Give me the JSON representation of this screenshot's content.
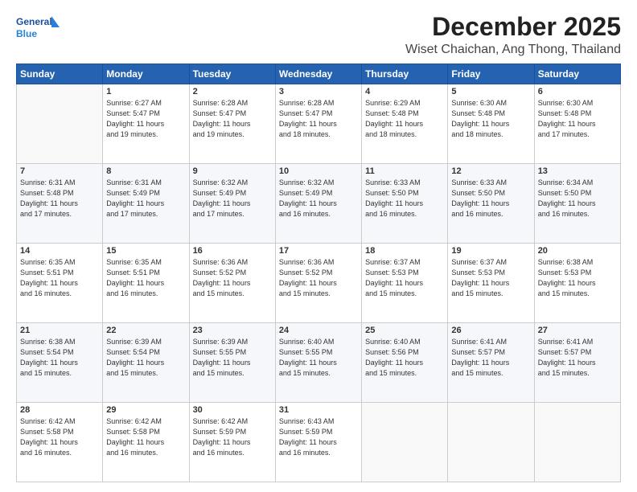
{
  "logo": {
    "line1": "General",
    "line2": "Blue"
  },
  "title": "December 2025",
  "subtitle": "Wiset Chaichan, Ang Thong, Thailand",
  "header_days": [
    "Sunday",
    "Monday",
    "Tuesday",
    "Wednesday",
    "Thursday",
    "Friday",
    "Saturday"
  ],
  "weeks": [
    [
      {
        "day": "",
        "info": ""
      },
      {
        "day": "1",
        "info": "Sunrise: 6:27 AM\nSunset: 5:47 PM\nDaylight: 11 hours\nand 19 minutes."
      },
      {
        "day": "2",
        "info": "Sunrise: 6:28 AM\nSunset: 5:47 PM\nDaylight: 11 hours\nand 19 minutes."
      },
      {
        "day": "3",
        "info": "Sunrise: 6:28 AM\nSunset: 5:47 PM\nDaylight: 11 hours\nand 18 minutes."
      },
      {
        "day": "4",
        "info": "Sunrise: 6:29 AM\nSunset: 5:48 PM\nDaylight: 11 hours\nand 18 minutes."
      },
      {
        "day": "5",
        "info": "Sunrise: 6:30 AM\nSunset: 5:48 PM\nDaylight: 11 hours\nand 18 minutes."
      },
      {
        "day": "6",
        "info": "Sunrise: 6:30 AM\nSunset: 5:48 PM\nDaylight: 11 hours\nand 17 minutes."
      }
    ],
    [
      {
        "day": "7",
        "info": "Sunrise: 6:31 AM\nSunset: 5:48 PM\nDaylight: 11 hours\nand 17 minutes."
      },
      {
        "day": "8",
        "info": "Sunrise: 6:31 AM\nSunset: 5:49 PM\nDaylight: 11 hours\nand 17 minutes."
      },
      {
        "day": "9",
        "info": "Sunrise: 6:32 AM\nSunset: 5:49 PM\nDaylight: 11 hours\nand 17 minutes."
      },
      {
        "day": "10",
        "info": "Sunrise: 6:32 AM\nSunset: 5:49 PM\nDaylight: 11 hours\nand 16 minutes."
      },
      {
        "day": "11",
        "info": "Sunrise: 6:33 AM\nSunset: 5:50 PM\nDaylight: 11 hours\nand 16 minutes."
      },
      {
        "day": "12",
        "info": "Sunrise: 6:33 AM\nSunset: 5:50 PM\nDaylight: 11 hours\nand 16 minutes."
      },
      {
        "day": "13",
        "info": "Sunrise: 6:34 AM\nSunset: 5:50 PM\nDaylight: 11 hours\nand 16 minutes."
      }
    ],
    [
      {
        "day": "14",
        "info": "Sunrise: 6:35 AM\nSunset: 5:51 PM\nDaylight: 11 hours\nand 16 minutes."
      },
      {
        "day": "15",
        "info": "Sunrise: 6:35 AM\nSunset: 5:51 PM\nDaylight: 11 hours\nand 16 minutes."
      },
      {
        "day": "16",
        "info": "Sunrise: 6:36 AM\nSunset: 5:52 PM\nDaylight: 11 hours\nand 15 minutes."
      },
      {
        "day": "17",
        "info": "Sunrise: 6:36 AM\nSunset: 5:52 PM\nDaylight: 11 hours\nand 15 minutes."
      },
      {
        "day": "18",
        "info": "Sunrise: 6:37 AM\nSunset: 5:53 PM\nDaylight: 11 hours\nand 15 minutes."
      },
      {
        "day": "19",
        "info": "Sunrise: 6:37 AM\nSunset: 5:53 PM\nDaylight: 11 hours\nand 15 minutes."
      },
      {
        "day": "20",
        "info": "Sunrise: 6:38 AM\nSunset: 5:53 PM\nDaylight: 11 hours\nand 15 minutes."
      }
    ],
    [
      {
        "day": "21",
        "info": "Sunrise: 6:38 AM\nSunset: 5:54 PM\nDaylight: 11 hours\nand 15 minutes."
      },
      {
        "day": "22",
        "info": "Sunrise: 6:39 AM\nSunset: 5:54 PM\nDaylight: 11 hours\nand 15 minutes."
      },
      {
        "day": "23",
        "info": "Sunrise: 6:39 AM\nSunset: 5:55 PM\nDaylight: 11 hours\nand 15 minutes."
      },
      {
        "day": "24",
        "info": "Sunrise: 6:40 AM\nSunset: 5:55 PM\nDaylight: 11 hours\nand 15 minutes."
      },
      {
        "day": "25",
        "info": "Sunrise: 6:40 AM\nSunset: 5:56 PM\nDaylight: 11 hours\nand 15 minutes."
      },
      {
        "day": "26",
        "info": "Sunrise: 6:41 AM\nSunset: 5:57 PM\nDaylight: 11 hours\nand 15 minutes."
      },
      {
        "day": "27",
        "info": "Sunrise: 6:41 AM\nSunset: 5:57 PM\nDaylight: 11 hours\nand 15 minutes."
      }
    ],
    [
      {
        "day": "28",
        "info": "Sunrise: 6:42 AM\nSunset: 5:58 PM\nDaylight: 11 hours\nand 16 minutes."
      },
      {
        "day": "29",
        "info": "Sunrise: 6:42 AM\nSunset: 5:58 PM\nDaylight: 11 hours\nand 16 minutes."
      },
      {
        "day": "30",
        "info": "Sunrise: 6:42 AM\nSunset: 5:59 PM\nDaylight: 11 hours\nand 16 minutes."
      },
      {
        "day": "31",
        "info": "Sunrise: 6:43 AM\nSunset: 5:59 PM\nDaylight: 11 hours\nand 16 minutes."
      },
      {
        "day": "",
        "info": ""
      },
      {
        "day": "",
        "info": ""
      },
      {
        "day": "",
        "info": ""
      }
    ]
  ]
}
